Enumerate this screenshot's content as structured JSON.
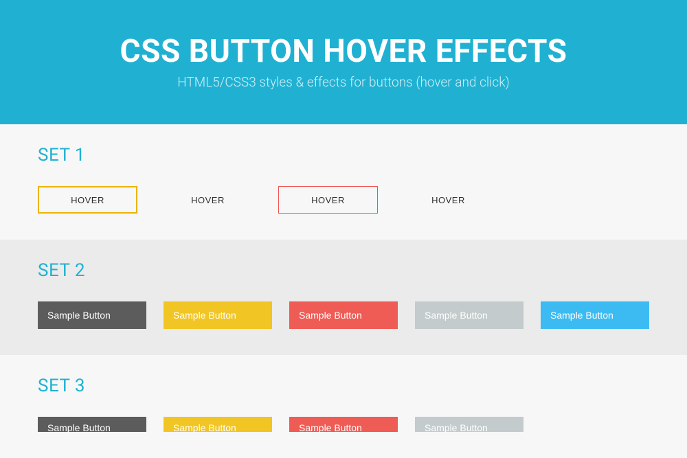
{
  "hero": {
    "title": "CSS BUTTON HOVER EFFECTS",
    "subtitle": "HTML5/CSS3 styles & effects for buttons (hover and click)"
  },
  "sections": {
    "set1": {
      "title": "SET 1",
      "buttons": [
        "HOVER",
        "HOVER",
        "HOVER",
        "HOVER"
      ]
    },
    "set2": {
      "title": "SET 2",
      "buttons": [
        "Sample Button",
        "Sample Button",
        "Sample Button",
        "Sample Button",
        "Sample Button"
      ]
    },
    "set3": {
      "title": "SET 3",
      "buttons": [
        "Sample Button",
        "Sample Button",
        "Sample Button",
        "Sample Button"
      ]
    }
  },
  "colors": {
    "primary": "#20b1d2",
    "dark": "#5c5c5c",
    "yellow": "#f1c523",
    "red": "#ef5b55",
    "gray": "#c3cbcc",
    "blue": "#3cbbf2",
    "outlineYellow": "#eab400",
    "outlineRed": "#ef5350"
  }
}
